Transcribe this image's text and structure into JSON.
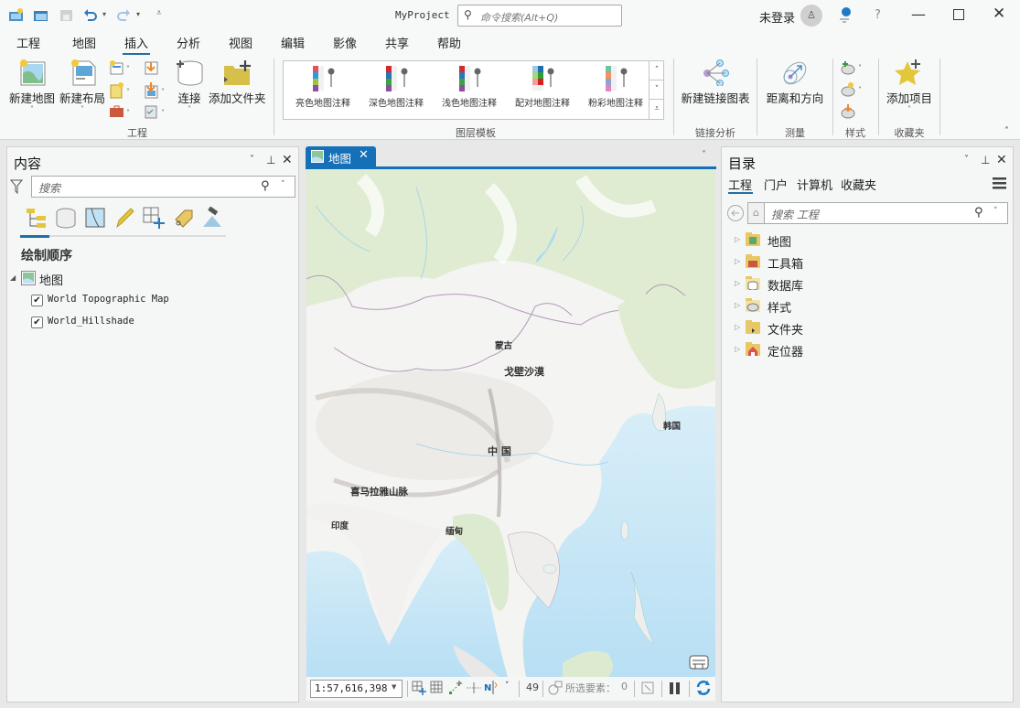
{
  "app": {
    "title": "MyProject",
    "command_search_placeholder": "命令搜索(Alt+Q)",
    "user_status": "未登录",
    "help": "?",
    "accent_color": "#1f6fa8"
  },
  "ribbon_tabs": [
    {
      "label": "工程"
    },
    {
      "label": "地图"
    },
    {
      "label": "插入",
      "active": true
    },
    {
      "label": "分析"
    },
    {
      "label": "视图"
    },
    {
      "label": "编辑"
    },
    {
      "label": "影像"
    },
    {
      "label": "共享"
    },
    {
      "label": "帮助"
    }
  ],
  "ribbon": {
    "project_group": {
      "label": "工程",
      "new_map": "新建地图",
      "new_layout": "新建布局",
      "connect": "连接",
      "add_folder": "添加文件夹"
    },
    "layer_templates": {
      "label": "图层模板",
      "items": [
        {
          "label": "亮色地图注释",
          "colors": [
            "#e8505b",
            "#2a9fd6",
            "#9bc43f",
            "#8e4f9c"
          ]
        },
        {
          "label": "深色地图注释",
          "colors": [
            "#d42a2a",
            "#2b74b5",
            "#3ea045",
            "#8c4d9a"
          ]
        },
        {
          "label": "浅色地图注释",
          "colors": [
            "#d42a2a",
            "#2b74b5",
            "#3ea045",
            "#8c4d9a"
          ]
        },
        {
          "label": "配对地图注释",
          "colors": [
            "#9fc9e3",
            "#1f6fb0",
            "#a5d67f",
            "#2c9e35",
            "#f39c9a",
            "#d81e1e"
          ]
        },
        {
          "label": "粉彩地图注释",
          "colors": [
            "#6dc4a3",
            "#f3925c",
            "#8fa2cf",
            "#e483c4"
          ]
        }
      ]
    },
    "link_analysis": {
      "label": "链接分析",
      "new_link_chart": "新建链接图表"
    },
    "measure": {
      "label": "测量",
      "distance_direction": "距离和方向"
    },
    "style": {
      "label": "样式"
    },
    "favorites": {
      "label": "收藏夹",
      "add_item": "添加项目"
    }
  },
  "contents_pane": {
    "title": "内容",
    "search_placeholder": "搜索",
    "section_title": "绘制顺序",
    "map_name": "地图",
    "layers": [
      {
        "name": "World Topographic Map",
        "checked": true
      },
      {
        "name": "World_Hillshade",
        "checked": true
      }
    ]
  },
  "map_view": {
    "tab_label": "地图",
    "labels": {
      "mongolia": "蒙古",
      "gobi": "戈壁沙漠",
      "korea": "韩国",
      "china": "中 国",
      "himalaya": "喜马拉雅山脉",
      "india": "印度",
      "myanmar": "缅甸"
    },
    "scale": "1:57,616,398",
    "status_number": "49",
    "selected_features_label": "所选要素：",
    "selected_features_count": "0"
  },
  "catalog_pane": {
    "title": "目录",
    "tabs": [
      {
        "label": "工程",
        "active": true
      },
      {
        "label": "门户"
      },
      {
        "label": "计算机"
      },
      {
        "label": "收藏夹"
      }
    ],
    "search_placeholder": "搜索 工程",
    "items": [
      {
        "label": "地图",
        "icon": "map-folder-icon"
      },
      {
        "label": "工具箱",
        "icon": "toolbox-folder-icon"
      },
      {
        "label": "数据库",
        "icon": "database-folder-icon"
      },
      {
        "label": "样式",
        "icon": "style-folder-icon"
      },
      {
        "label": "文件夹",
        "icon": "folder-icon"
      },
      {
        "label": "定位器",
        "icon": "locator-folder-icon"
      }
    ]
  }
}
